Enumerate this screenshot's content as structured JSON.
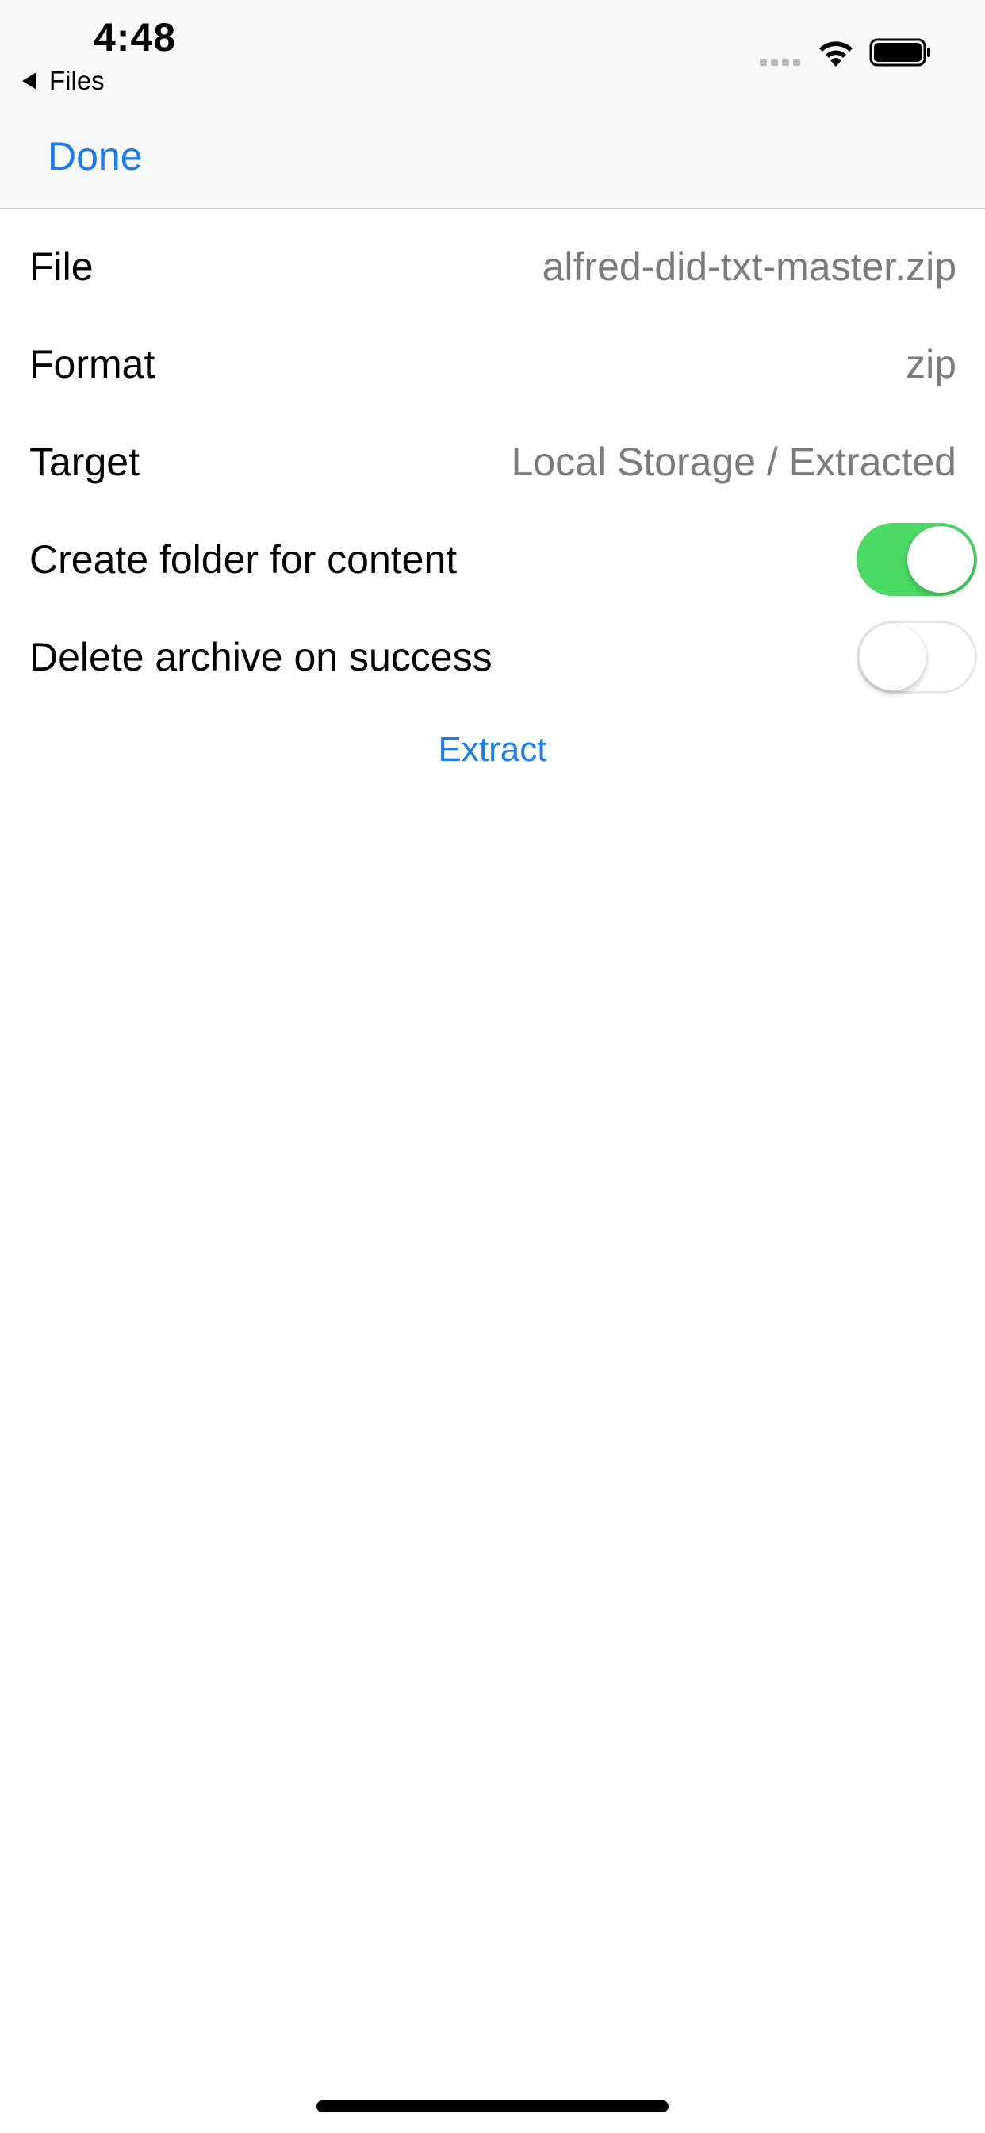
{
  "status_bar": {
    "time": "4:48",
    "back_app_label": "Files",
    "icons": [
      "signal-dots-icon",
      "wifi-icon",
      "battery-icon"
    ]
  },
  "nav": {
    "done_label": "Done"
  },
  "rows": {
    "file": {
      "label": "File",
      "value": "alfred-did-txt-master.zip"
    },
    "format": {
      "label": "Format",
      "value": "zip"
    },
    "target": {
      "label": "Target",
      "value": "Local Storage / Extracted"
    },
    "create_folder": {
      "label": "Create folder for content",
      "on": true
    },
    "delete_archive": {
      "label": "Delete archive on success",
      "on": false
    }
  },
  "actions": {
    "extract_label": "Extract"
  },
  "colors": {
    "accent": "#1a7cf0",
    "toggle_on": "#4cd964",
    "secondary_text": "#7a7a7f",
    "nav_background": "#f8f8f8"
  }
}
